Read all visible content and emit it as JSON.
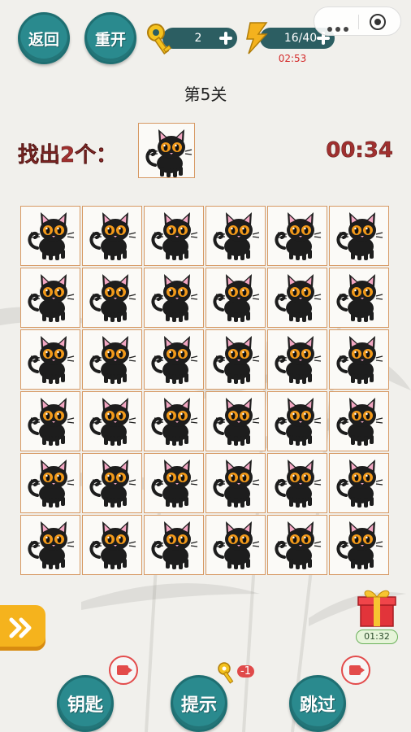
{
  "top_bar": {
    "back_label": "返回",
    "restart_label": "重开",
    "keys_count": "2",
    "energy": "16/40",
    "energy_timer": "02:53"
  },
  "level": {
    "title": "第5关"
  },
  "task": {
    "find_label": "找出2个：",
    "countdown": "00:34",
    "target_icon": "black-cat-icon"
  },
  "grid": {
    "rows": 6,
    "cols": 6,
    "cells": [
      "black-cat-icon",
      "black-cat-icon",
      "black-cat-icon",
      "black-cat-icon",
      "black-cat-icon",
      "black-cat-icon",
      "black-cat-icon",
      "black-cat-icon",
      "black-cat-icon",
      "black-cat-icon",
      "black-cat-icon",
      "black-cat-icon",
      "black-cat-icon",
      "black-cat-icon",
      "black-cat-icon",
      "black-cat-icon",
      "black-cat-icon",
      "black-cat-icon",
      "black-cat-icon",
      "black-cat-icon",
      "black-cat-icon",
      "black-cat-icon",
      "black-cat-icon",
      "black-cat-icon",
      "black-cat-icon",
      "black-cat-icon",
      "black-cat-icon",
      "black-cat-icon",
      "black-cat-icon",
      "black-cat-icon",
      "black-cat-icon",
      "black-cat-icon",
      "black-cat-icon",
      "black-cat-icon",
      "black-cat-icon",
      "black-cat-icon"
    ]
  },
  "side": {
    "gift_timer": "01:32"
  },
  "bottom_bar": {
    "keys_label": "钥匙",
    "hint_label": "提示",
    "hint_cost": "-1",
    "skip_label": "跳过"
  },
  "colors": {
    "teal": "#2a8a8e",
    "red_text": "#a0302f",
    "cell_border": "#d79963",
    "gold": "#f5b31d"
  }
}
